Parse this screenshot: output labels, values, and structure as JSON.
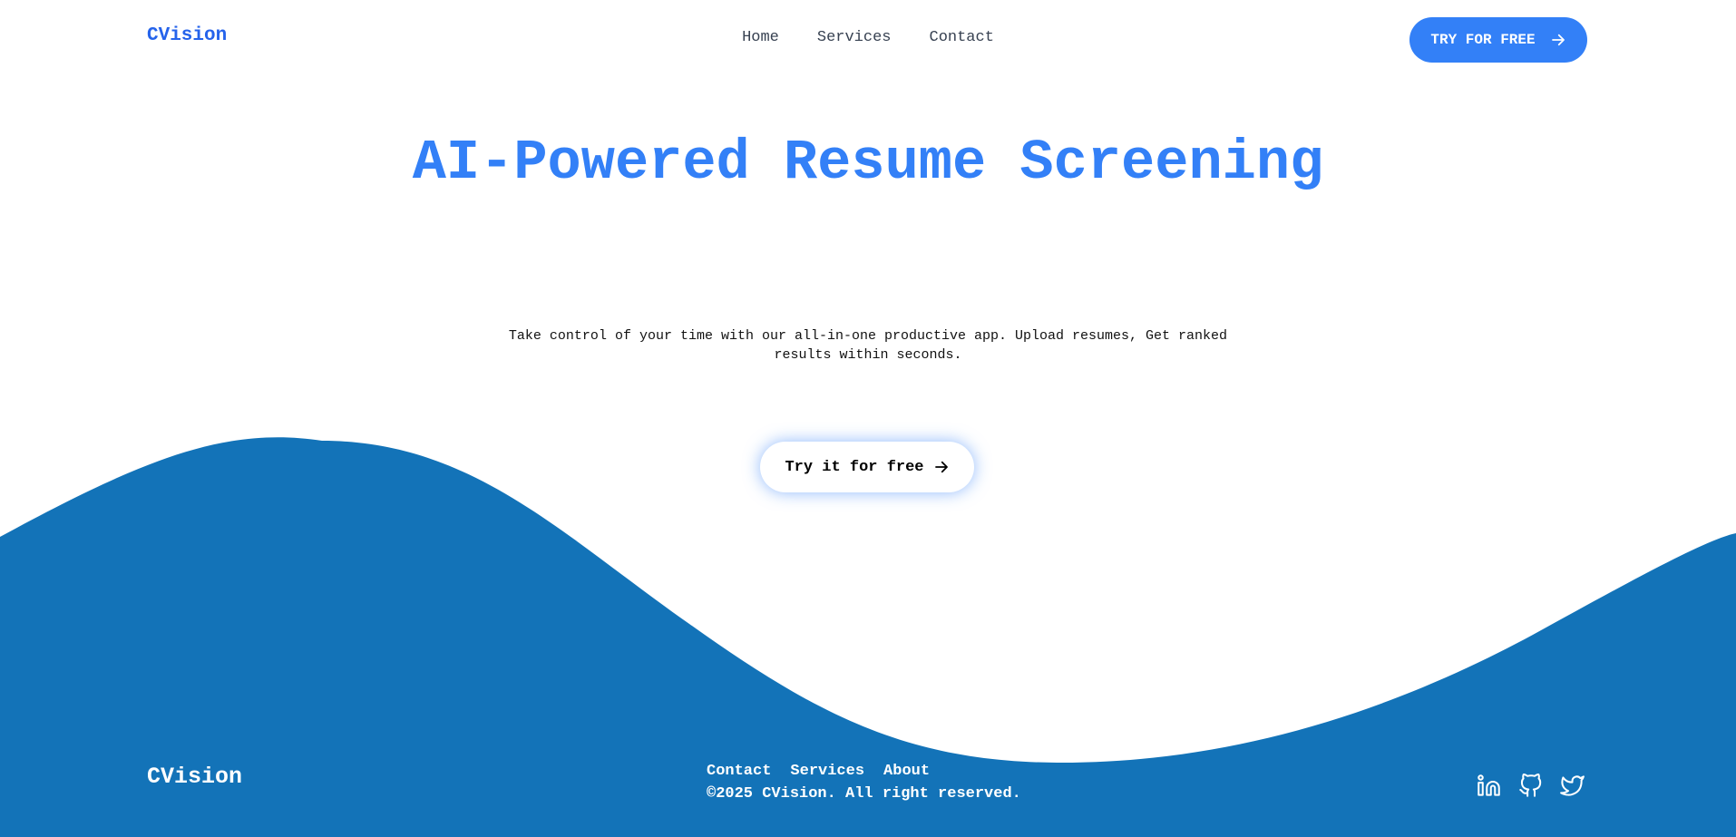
{
  "header": {
    "logo": "CVision",
    "nav": [
      {
        "label": "Home"
      },
      {
        "label": "Services"
      },
      {
        "label": "Contact"
      }
    ],
    "cta_label": "TRY FOR FREE",
    "cta_icon": "arrow-right-icon"
  },
  "hero": {
    "title": "AI-Powered Resume Screening",
    "subtitle": "Take control of your time with our all-in-one productive app. Upload resumes, Get ranked results within seconds.",
    "cta_label": "Try it for free",
    "cta_icon": "arrow-right-icon"
  },
  "footer": {
    "logo": "CVision",
    "links": [
      {
        "label": "Contact"
      },
      {
        "label": "Services"
      },
      {
        "label": "About"
      }
    ],
    "copyright": "©2025 CVision. All right reserved.",
    "socials": [
      "linkedin-icon",
      "github-icon",
      "twitter-icon"
    ]
  },
  "colors": {
    "accent": "#3380f7",
    "logo": "#2563eb",
    "wave": "#1373b8",
    "background": "#ffffff"
  }
}
